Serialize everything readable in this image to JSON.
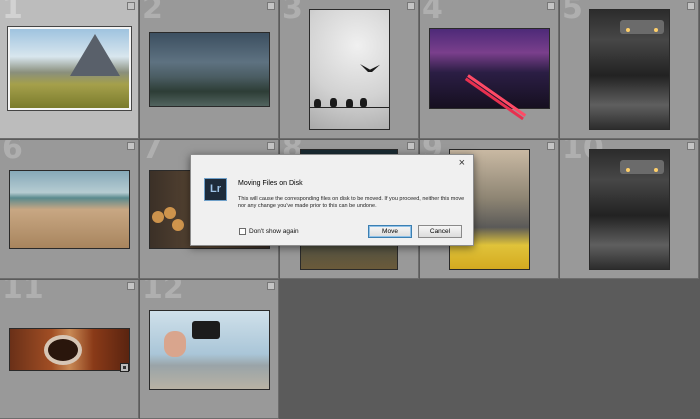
{
  "cells": [
    {
      "number": "1"
    },
    {
      "number": "2"
    },
    {
      "number": "3"
    },
    {
      "number": "4"
    },
    {
      "number": "5"
    },
    {
      "number": "6"
    },
    {
      "number": "7"
    },
    {
      "number": "8"
    },
    {
      "number": "9"
    },
    {
      "number": "10"
    },
    {
      "number": "11"
    },
    {
      "number": "12"
    }
  ],
  "dialog": {
    "logo_text": "Lr",
    "title": "Moving Files on Disk",
    "message": "This will cause the corresponding files on disk to be moved. If you proceed, neither this move nor any change you've made prior to this can be undone.",
    "checkbox_label": "Don't show again",
    "move_label": "Move",
    "cancel_label": "Cancel",
    "close_glyph": "×"
  },
  "icons": {
    "close": "close-icon",
    "flag": "flag-icon",
    "badge": "metadata-badge-icon"
  }
}
